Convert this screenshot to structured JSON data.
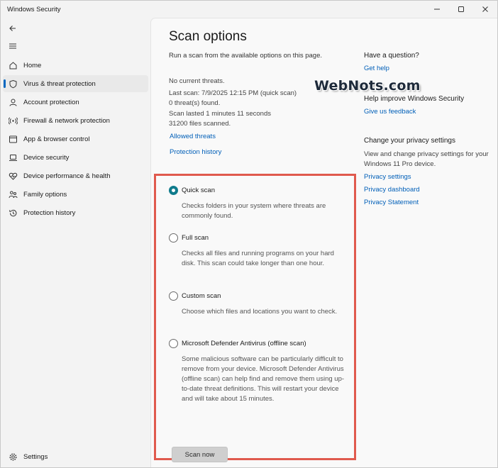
{
  "app": {
    "title": "Windows Security"
  },
  "window_controls": {
    "minimize": "minimize",
    "maximize": "maximize",
    "close": "close"
  },
  "sidebar": {
    "items": [
      {
        "label": "Home",
        "icon": "home-icon"
      },
      {
        "label": "Virus & threat protection",
        "icon": "shield-icon",
        "active": true
      },
      {
        "label": "Account protection",
        "icon": "person-icon"
      },
      {
        "label": "Firewall & network protection",
        "icon": "network-icon"
      },
      {
        "label": "App & browser control",
        "icon": "app-browser-icon"
      },
      {
        "label": "Device security",
        "icon": "laptop-icon"
      },
      {
        "label": "Device performance & health",
        "icon": "heart-icon"
      },
      {
        "label": "Family options",
        "icon": "family-icon"
      },
      {
        "label": "Protection history",
        "icon": "history-icon"
      }
    ],
    "settings_label": "Settings"
  },
  "main": {
    "title": "Scan options",
    "subtitle": "Run a scan from the available options on this page.",
    "status": {
      "line1": "No current threats.",
      "line2": "Last scan: 7/9/2025 12:15 PM (quick scan)",
      "line3": "0 threat(s) found.",
      "line4": "Scan lasted 1 minutes 11 seconds",
      "line5": "31200 files scanned."
    },
    "links": {
      "allowed_threats": "Allowed threats",
      "protection_history": "Protection history"
    },
    "options": [
      {
        "label": "Quick scan",
        "desc": "Checks folders in your system where threats are commonly found.",
        "selected": true
      },
      {
        "label": "Full scan",
        "desc": "Checks all files and running programs on your hard disk. This scan could take longer than one hour.",
        "selected": false
      },
      {
        "label": "Custom scan",
        "desc": "Choose which files and locations you want to check.",
        "selected": false
      },
      {
        "label": "Microsoft Defender Antivirus (offline scan)",
        "desc": "Some malicious software can be particularly difficult to remove from your device. Microsoft Defender Antivirus (offline scan) can help find and remove them using up-to-date threat definitions. This will restart your device and will take about 15 minutes.",
        "selected": false
      }
    ],
    "scan_button": "Scan now"
  },
  "right_panel": {
    "question_heading": "Have a question?",
    "get_help": "Get help",
    "improve_heading": "Help improve Windows Security",
    "feedback": "Give us feedback",
    "privacy_heading": "Change your privacy settings",
    "privacy_text": "View and change privacy settings for your Windows 11 Pro device.",
    "privacy_settings": "Privacy settings",
    "privacy_dashboard": "Privacy dashboard",
    "privacy_statement": "Privacy Statement"
  },
  "watermark": "WebNots.com",
  "colors": {
    "accent": "#0f7b8c",
    "link": "#005fb8",
    "highlight_box": "#e05a4e",
    "nav_indicator": "#0067c0"
  }
}
